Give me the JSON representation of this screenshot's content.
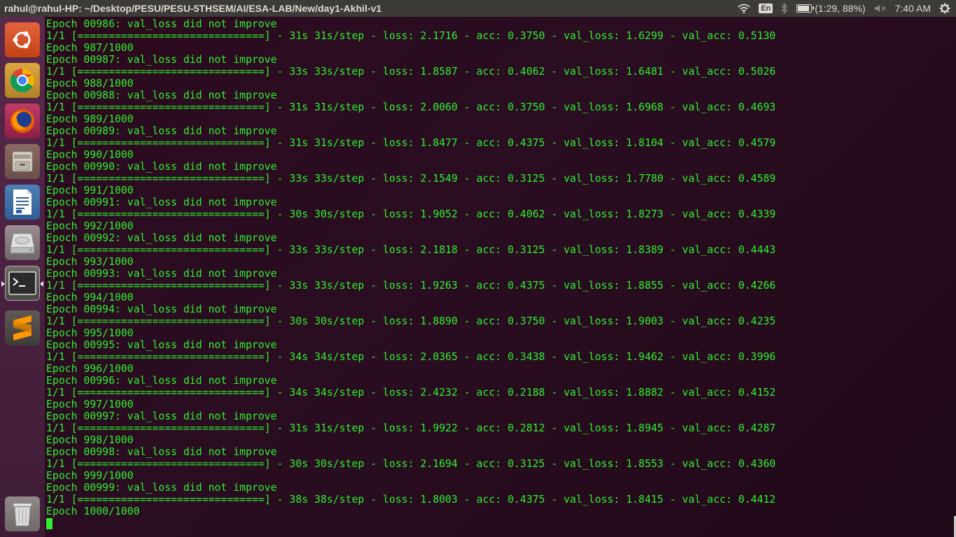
{
  "top_panel": {
    "window_title": "rahul@rahul-HP: ~/Desktop/PESU/PESU-5THSEM/AI/ESA-LAB/New/day1-Akhil-v1",
    "indicators": {
      "wifi_icon": "wifi-icon",
      "language": "En",
      "bluetooth_icon": "bluetooth-icon",
      "battery_text": "(1:29, 88%)",
      "battery_level_percent": 88,
      "volume_icon": "volume-muted-icon",
      "clock": "7:40 AM",
      "settings_icon": "gear-icon"
    }
  },
  "launcher": {
    "items": [
      {
        "name": "ubuntu-dash",
        "icon": "ubuntu-logo-icon"
      },
      {
        "name": "chrome",
        "icon": "chrome-icon"
      },
      {
        "name": "firefox",
        "icon": "firefox-icon"
      },
      {
        "name": "files",
        "icon": "file-cabinet-icon"
      },
      {
        "name": "libreoffice-writer",
        "icon": "document-icon"
      },
      {
        "name": "disks",
        "icon": "hard-drive-icon"
      },
      {
        "name": "terminal",
        "icon": "terminal-icon",
        "active": true
      },
      {
        "name": "sublime-text",
        "icon": "sublime-icon"
      },
      {
        "name": "trash",
        "icon": "trash-icon"
      }
    ]
  },
  "terminal": {
    "text_color": "#2ef02e",
    "lines": [
      "Epoch 00986: val_loss did not improve",
      "1/1 [==============================] - 31s 31s/step - loss: 2.1716 - acc: 0.3750 - val_loss: 1.6299 - val_acc: 0.5130",
      "Epoch 987/1000",
      "Epoch 00987: val_loss did not improve",
      "1/1 [==============================] - 33s 33s/step - loss: 1.8587 - acc: 0.4062 - val_loss: 1.6481 - val_acc: 0.5026",
      "Epoch 988/1000",
      "Epoch 00988: val_loss did not improve",
      "1/1 [==============================] - 31s 31s/step - loss: 2.0060 - acc: 0.3750 - val_loss: 1.6968 - val_acc: 0.4693",
      "Epoch 989/1000",
      "Epoch 00989: val_loss did not improve",
      "1/1 [==============================] - 31s 31s/step - loss: 1.8477 - acc: 0.4375 - val_loss: 1.8104 - val_acc: 0.4579",
      "Epoch 990/1000",
      "Epoch 00990: val_loss did not improve",
      "1/1 [==============================] - 33s 33s/step - loss: 2.1549 - acc: 0.3125 - val_loss: 1.7780 - val_acc: 0.4589",
      "Epoch 991/1000",
      "Epoch 00991: val_loss did not improve",
      "1/1 [==============================] - 30s 30s/step - loss: 1.9052 - acc: 0.4062 - val_loss: 1.8273 - val_acc: 0.4339",
      "Epoch 992/1000",
      "Epoch 00992: val_loss did not improve",
      "1/1 [==============================] - 33s 33s/step - loss: 2.1818 - acc: 0.3125 - val_loss: 1.8389 - val_acc: 0.4443",
      "Epoch 993/1000",
      "Epoch 00993: val_loss did not improve",
      "1/1 [==============================] - 33s 33s/step - loss: 1.9263 - acc: 0.4375 - val_loss: 1.8855 - val_acc: 0.4266",
      "Epoch 994/1000",
      "Epoch 00994: val_loss did not improve",
      "1/1 [==============================] - 30s 30s/step - loss: 1.8890 - acc: 0.3750 - val_loss: 1.9003 - val_acc: 0.4235",
      "Epoch 995/1000",
      "Epoch 00995: val_loss did not improve",
      "1/1 [==============================] - 34s 34s/step - loss: 2.0365 - acc: 0.3438 - val_loss: 1.9462 - val_acc: 0.3996",
      "Epoch 996/1000",
      "Epoch 00996: val_loss did not improve",
      "1/1 [==============================] - 34s 34s/step - loss: 2.4232 - acc: 0.2188 - val_loss: 1.8882 - val_acc: 0.4152",
      "Epoch 997/1000",
      "Epoch 00997: val_loss did not improve",
      "1/1 [==============================] - 31s 31s/step - loss: 1.9922 - acc: 0.2812 - val_loss: 1.8945 - val_acc: 0.4287",
      "Epoch 998/1000",
      "Epoch 00998: val_loss did not improve",
      "1/1 [==============================] - 30s 30s/step - loss: 2.1694 - acc: 0.3125 - val_loss: 1.8553 - val_acc: 0.4360",
      "Epoch 999/1000",
      "Epoch 00999: val_loss did not improve",
      "1/1 [==============================] - 38s 38s/step - loss: 1.8003 - acc: 0.4375 - val_loss: 1.8415 - val_acc: 0.4412",
      "Epoch 1000/1000"
    ]
  }
}
